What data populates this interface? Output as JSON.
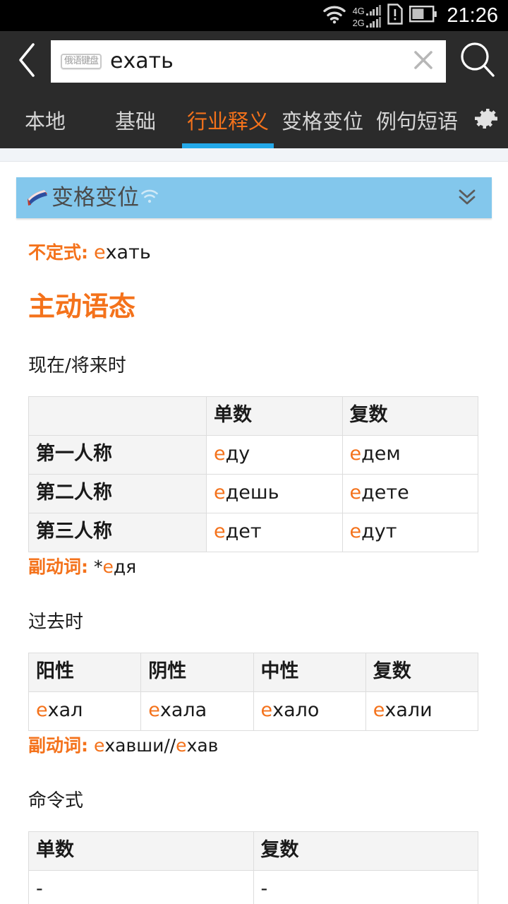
{
  "statusbar": {
    "time": "21:26",
    "network_primary": "4G",
    "network_secondary": "2G",
    "icons": [
      "wifi-icon",
      "signal-icon",
      "sim-card-icon",
      "battery-icon"
    ]
  },
  "search": {
    "keyboard_badge": "俄语键盘",
    "value": "ехать",
    "placeholder": "",
    "back_icon": "back-chevron-icon",
    "clear_icon": "clear-icon",
    "search_icon": "search-icon"
  },
  "tabs": {
    "items": [
      {
        "label": "本地",
        "active": false
      },
      {
        "label": "基础",
        "active": false
      },
      {
        "label": "行业释义",
        "active": true
      },
      {
        "label": "变格变位",
        "active": false
      },
      {
        "label": "例句短语",
        "active": false
      }
    ],
    "settings_icon": "gear-icon"
  },
  "card": {
    "title": "变格变位",
    "flag_icon": "book-flag-icon",
    "wifi_icon": "wifi-small-icon",
    "expand_icon": "double-chevron-down-icon"
  },
  "content": {
    "infinitive_label": "不定式:",
    "infinitive_accent": "е",
    "infinitive_rest": "хать",
    "voice_title": "主动语态",
    "present_section": "现在/将来时",
    "past_section": "过去时",
    "imperative_section": "命令式",
    "gerund_label_present": "副动词:",
    "gerund_present_prefix": "*",
    "gerund_present_accent": "е",
    "gerund_present_rest": "дя",
    "gerund_label_past": "副动词:",
    "gerund_past_accent1": "е",
    "gerund_past_rest1": "хавши//",
    "gerund_past_accent2": "е",
    "gerund_past_rest2": "хав"
  },
  "present_table": {
    "headers": [
      "",
      "单数",
      "复数"
    ],
    "rows": [
      {
        "person": "第一人称",
        "singular_accent": "е",
        "singular_rest": "ду",
        "plural_accent": "е",
        "plural_rest": "дем"
      },
      {
        "person": "第二人称",
        "singular_accent": "е",
        "singular_rest": "дешь",
        "plural_accent": "е",
        "plural_rest": "дете"
      },
      {
        "person": "第三人称",
        "singular_accent": "е",
        "singular_rest": "дет",
        "plural_accent": "е",
        "plural_rest": "дут"
      }
    ]
  },
  "past_table": {
    "headers": [
      "阳性",
      "阴性",
      "中性",
      "复数"
    ],
    "row": [
      {
        "accent": "е",
        "rest": "хал"
      },
      {
        "accent": "е",
        "rest": "хала"
      },
      {
        "accent": "е",
        "rest": "хало"
      },
      {
        "accent": "е",
        "rest": "хали"
      }
    ]
  },
  "imperative_table": {
    "headers": [
      "单数",
      "复数"
    ],
    "row": [
      "-",
      "-"
    ]
  },
  "colors": {
    "accent_orange": "#F4721B",
    "tab_underline_blue": "#23A8E8",
    "card_header_blue": "#83C7EC",
    "chrome_dark": "#2B2B2B",
    "status_black": "#000000",
    "table_header_gray": "#F4F4F4"
  }
}
